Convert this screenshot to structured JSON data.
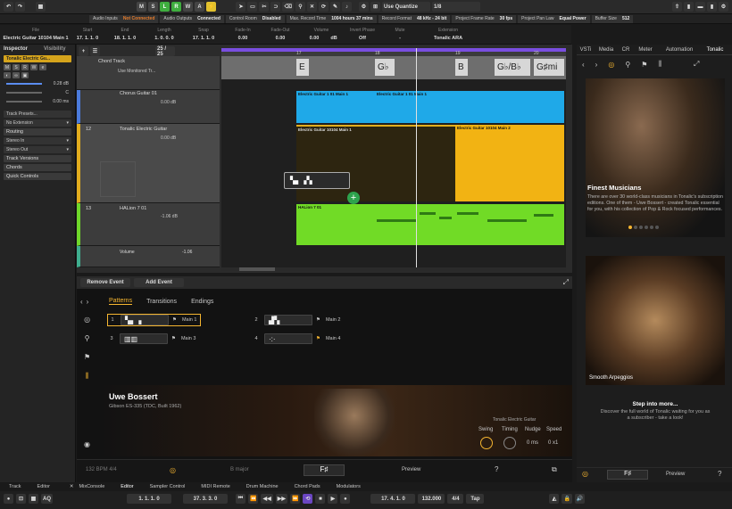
{
  "toolbar": {
    "undo": "↶",
    "redo": "↷",
    "grid_btn": "▦",
    "m": "M",
    "s": "S",
    "l": "L",
    "r": "R",
    "w": "W",
    "a": "A",
    "quantize_label": "Use Quantize",
    "quantize_value": "1/8"
  },
  "status": {
    "audio_inputs_label": "Audio Inputs",
    "audio_inputs_value": "Not Connected",
    "audio_outputs_label": "Audio Outputs",
    "audio_outputs_value": "Connected",
    "control_room_label": "Control Room",
    "control_room_value": "Disabled",
    "max_rec_label": "Max. Record Time",
    "max_rec_value": "1004 hours 37 mins",
    "rec_format_label": "Record Format",
    "rec_format_value": "48 kHz - 24 bit",
    "frame_rate_label": "Project Frame Rate",
    "frame_rate_value": "30 fps",
    "pan_law_label": "Project Pan Law",
    "pan_law_value": "Equal Power",
    "buffer_label": "Buffer Size",
    "buffer_value": "512"
  },
  "infoline": {
    "headers": [
      "File",
      "Start",
      "End",
      "Length",
      "Snap",
      "Fade-In",
      "Fade-Out",
      "Volume",
      "Invert Phase",
      "Mute",
      "Extension"
    ],
    "values": [
      "Electric Guitar 10104 Main 1",
      "17. 1. 1. 0",
      "18. 1. 1. 0",
      "1. 0. 0. 0",
      "17. 1. 1. 0",
      "0.00",
      "0.00",
      "0.00",
      "Off",
      "-",
      "Tonalic ARA"
    ],
    "vol_unit": "dB"
  },
  "inspector": {
    "tab1": "Inspector",
    "tab2": "Visibility",
    "track": "Tonalic Electric Gu...",
    "vol_val": "0.28 dB",
    "pan": "C",
    "delay": "0.00 ms",
    "preset": "Track Presets...",
    "ext": "No Extension",
    "routing": "Routing",
    "in": "Stereo In",
    "out": "Stereo Out",
    "track_versions": "Track Versions",
    "chords": "Chords",
    "quick": "Quick Controls"
  },
  "tracks": {
    "chord_name": "Chord Track",
    "chord_mode": "Use Monitored Tr...",
    "cg_name": "Chorus Guitar 01",
    "cg_vol": "0.00 dB",
    "tg_num": "12",
    "tg_name": "Tonalic Electric Guitar",
    "tg_vol": "0.00 dB",
    "ha_num": "13",
    "ha_name": "HALion 7 01",
    "ha_vol": "-1.06 dB",
    "auto_param": "Volume",
    "auto_val": "-1.06",
    "bar_count": "25 / 25"
  },
  "ruler": {
    "marks": [
      "17",
      "18",
      "19",
      "20"
    ]
  },
  "chords": [
    "E",
    "G♭",
    "B",
    "G♭/B♭",
    "G♯mi"
  ],
  "parts": {
    "cg1": "Electric Guitar 1 01 Main 1",
    "cg2": "Electric Guitar 1 01 Main 1",
    "eg1": "Electric Guitar 10104 Main 1",
    "eg2": "Electric Guitar 10104 Main 2",
    "ha": "HALion 7 01"
  },
  "editor": {
    "remove": "Remove Event",
    "add": "Add Event",
    "tabs": [
      "Patterns",
      "Transitions",
      "Endings"
    ],
    "patterns": [
      {
        "n": "1",
        "name": "Main 1"
      },
      {
        "n": "2",
        "name": "Main 2"
      },
      {
        "n": "3",
        "name": "Main 3"
      },
      {
        "n": "4",
        "name": "Main 4"
      }
    ],
    "artist": "Uwe Bossert",
    "guitar": "Gibson ES-335 (TDC, Built 1962)",
    "source": "Tonalic Electric Guitar",
    "swing": "Swing",
    "timing": "Timing",
    "nudge": "Nudge",
    "speed": "Speed",
    "nudge_val": "0 ms",
    "speed_val": "0 x1",
    "tempo": "132 BPM  4/4",
    "key": "B major",
    "chord": "F♯",
    "preview": "Preview"
  },
  "vst": {
    "tabs": [
      "VSTi",
      "Media",
      "CR",
      "Meter",
      "Automation",
      "Tonalic"
    ],
    "h1": "Finest Musicians",
    "p1": "There are over 30 world-class musicians in Tonalic's subscription editions. One of them - Uwe Bossert - created Tonalic essential for you, with his collection of Pop & Rock focused performances.",
    "cap": "Smooth Arpeggios",
    "h2": "Step into more...",
    "p2": "Discover the full world of Tonalic waiting for you as a subscriber - take a look!",
    "chord": "F♯",
    "preview": "Preview"
  },
  "bottom": {
    "tabs": [
      "Track",
      "Editor"
    ],
    "lower": [
      "MixConsole",
      "Editor",
      "Sampler Control",
      "MIDI Remote",
      "Drum Machine",
      "Chord Pads",
      "Modulators"
    ],
    "pos1": "1. 1. 1.  0",
    "pos2": "37. 3. 3.  0",
    "pos3": "17. 4. 1.  0",
    "tempo": "132.000",
    "sig": "4/4",
    "tap": "Tap",
    "aq": "AQ"
  }
}
